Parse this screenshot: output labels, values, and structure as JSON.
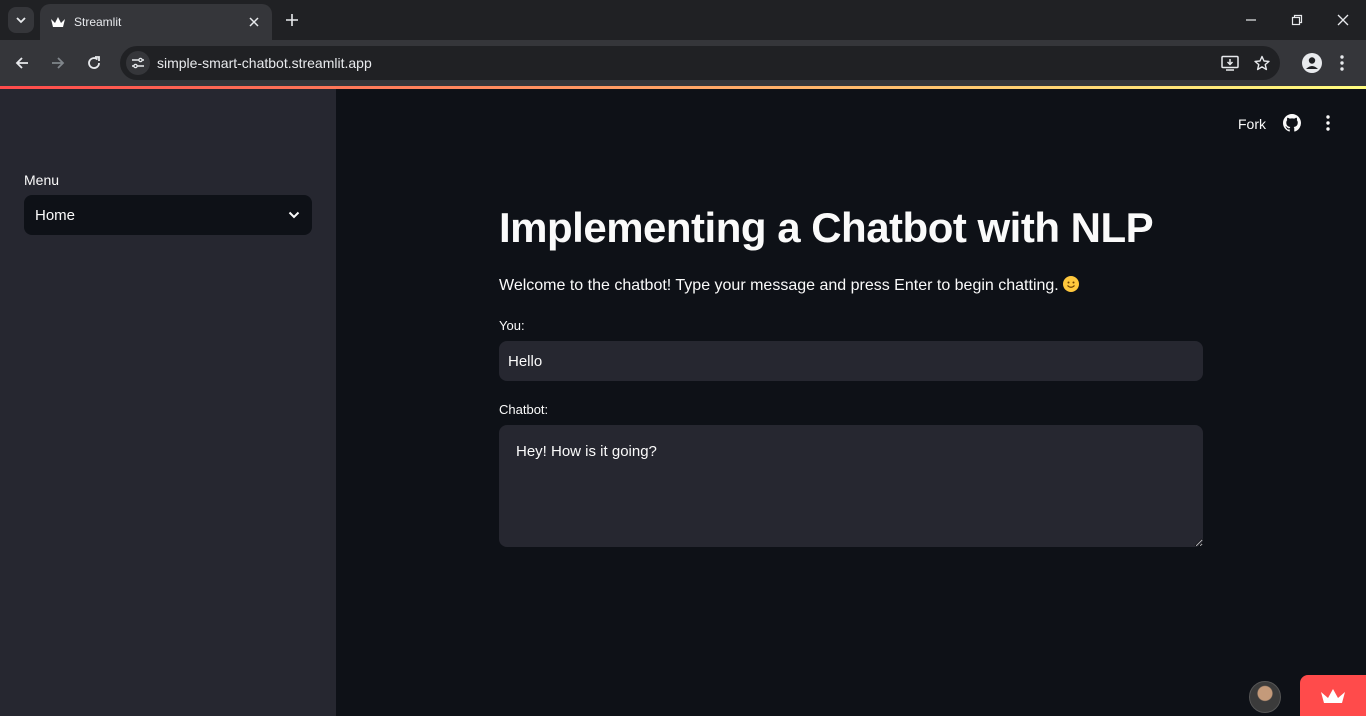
{
  "browser": {
    "tab_title": "Streamlit",
    "url": "simple-smart-chatbot.streamlit.app",
    "icons": {
      "tab_search": "chevron-down-icon",
      "favicon": "streamlit-crown-icon",
      "tab_close": "close-icon",
      "new_tab": "plus-icon",
      "back": "arrow-left-icon",
      "forward": "arrow-right-icon",
      "reload": "reload-icon",
      "site_info": "tune-icon",
      "install": "install-app-icon",
      "bookmark": "star-icon",
      "profile": "person-icon",
      "menu": "more-vertical-icon",
      "minimize": "minimize-icon",
      "restore": "restore-icon",
      "close_window": "close-icon"
    }
  },
  "sidebar": {
    "menu_label": "Menu",
    "select_value": "Home"
  },
  "header": {
    "fork_label": "Fork"
  },
  "main": {
    "title": "Implementing a Chatbot with NLP",
    "welcome": "Welcome to the chatbot! Type your message and press Enter to begin chatting.",
    "you_label": "You:",
    "you_value": "Hello",
    "chatbot_label": "Chatbot:",
    "chatbot_value": "Hey! How is it going?"
  },
  "colors": {
    "app_bg": "#0e1117",
    "sidebar_bg": "#262730",
    "input_bg": "#262730",
    "accent": "#ff4b4b",
    "text": "#fafafa"
  }
}
